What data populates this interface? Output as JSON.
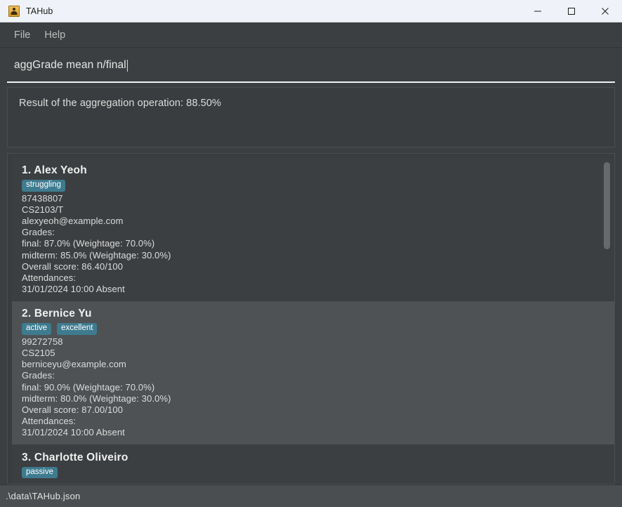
{
  "window": {
    "title": "TAHub",
    "icon": "app-person-icon",
    "controls": {
      "minimize": "minimize",
      "maximize": "maximize",
      "close": "close"
    }
  },
  "menubar": {
    "items": [
      {
        "label": "File"
      },
      {
        "label": "Help"
      }
    ]
  },
  "command": {
    "value": "aggGrade mean n/final",
    "placeholder": "Enter command here..."
  },
  "result": {
    "text": "Result of the aggregation operation: 88.50%"
  },
  "persons": [
    {
      "index": "1.",
      "name": "Alex Yeoh",
      "selected": false,
      "tags": [
        "struggling"
      ],
      "phone": "87438807",
      "module": "CS2103/T",
      "email": "alexyeoh@example.com",
      "grades_label": "Grades:",
      "grades": [
        "final: 87.0% (Weightage: 70.0%)",
        "midterm: 85.0% (Weightage: 30.0%)"
      ],
      "overall": "Overall score: 86.40/100",
      "attendances_label": "Attendances:",
      "attendances": [
        "31/01/2024 10:00 Absent"
      ]
    },
    {
      "index": "2.",
      "name": "Bernice Yu",
      "selected": true,
      "tags": [
        "active",
        "excellent"
      ],
      "phone": "99272758",
      "module": "CS2105",
      "email": "berniceyu@example.com",
      "grades_label": "Grades:",
      "grades": [
        "final: 90.0% (Weightage: 70.0%)",
        "midterm: 80.0% (Weightage: 30.0%)"
      ],
      "overall": "Overall score: 87.00/100",
      "attendances_label": "Attendances:",
      "attendances": [
        "31/01/2024 10:00 Absent"
      ]
    },
    {
      "index": "3.",
      "name": "Charlotte Oliveiro",
      "selected": false,
      "tags": [
        "passive"
      ],
      "phone": "",
      "module": "",
      "email": "",
      "grades_label": "",
      "grades": [],
      "overall": "",
      "attendances_label": "",
      "attendances": []
    }
  ],
  "statusbar": {
    "path": ".\\data\\TAHub.json"
  },
  "colors": {
    "tag_background": "#3e7b8f",
    "selected_card": "#4e5254",
    "card_background": "#3c3f41",
    "panel_background": "#3a3d3f",
    "titlebar_background": "#eff3f9",
    "statusbar_background": "#4b4e50",
    "accent_icon": "#d79b2a"
  }
}
